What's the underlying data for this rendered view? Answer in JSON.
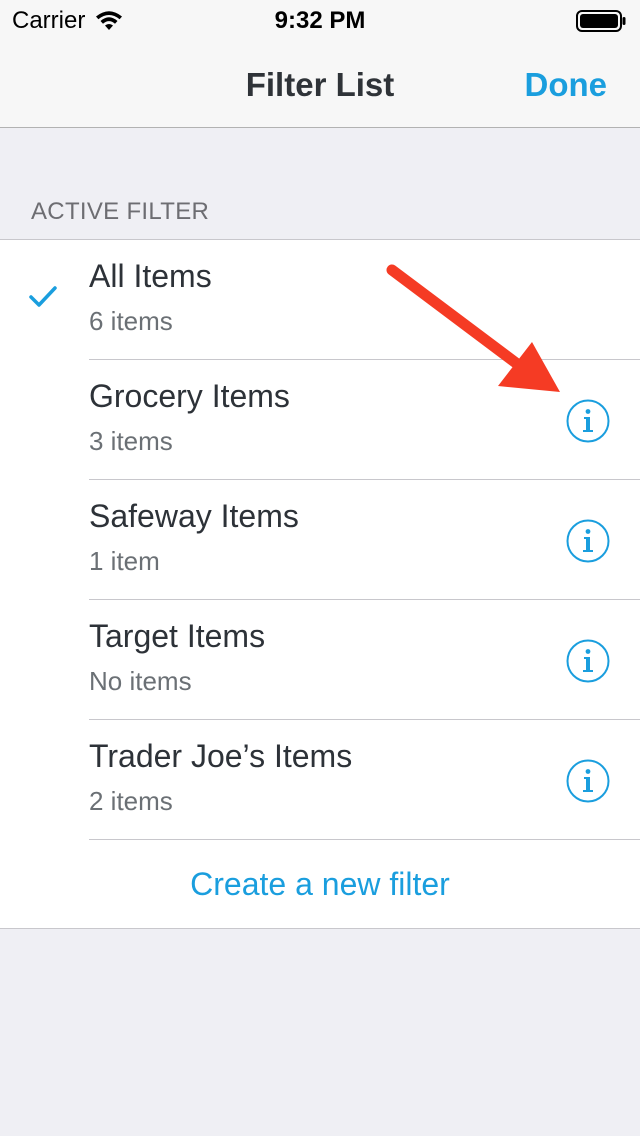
{
  "status_bar": {
    "carrier": "Carrier",
    "time": "9:32 PM"
  },
  "nav": {
    "title": "Filter List",
    "done_label": "Done"
  },
  "section": {
    "header": "ACTIVE FILTER"
  },
  "filters": [
    {
      "title": "All Items",
      "subtitle": "6 items",
      "checked": true,
      "has_info": false
    },
    {
      "title": "Grocery Items",
      "subtitle": "3 items",
      "checked": false,
      "has_info": true
    },
    {
      "title": "Safeway Items",
      "subtitle": "1 item",
      "checked": false,
      "has_info": true
    },
    {
      "title": "Target Items",
      "subtitle": "No items",
      "checked": false,
      "has_info": true
    },
    {
      "title": "Trader Joe’s Items",
      "subtitle": "2 items",
      "checked": false,
      "has_info": true
    }
  ],
  "create_label": "Create a new filter",
  "colors": {
    "accent": "#1a9ede",
    "annotation_arrow": "#f53b24",
    "background": "#efeff4"
  },
  "icons": {
    "wifi": "wifi-icon",
    "battery": "battery-icon",
    "check": "checkmark-icon",
    "info": "info-circle-icon",
    "annotation": "red-arrow-icon"
  }
}
